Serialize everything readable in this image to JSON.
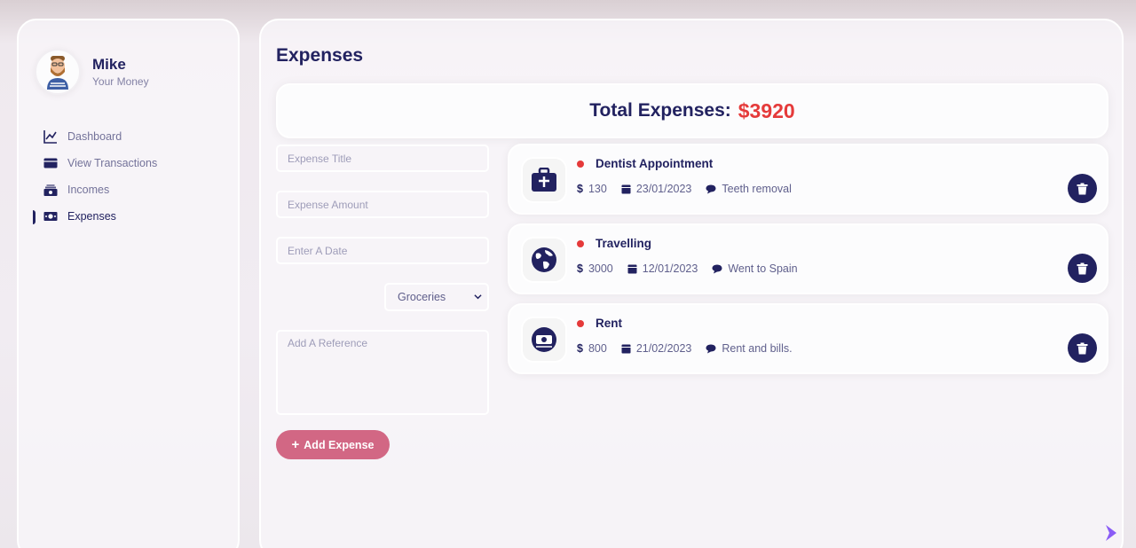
{
  "user": {
    "name": "Mike",
    "subtitle": "Your Money"
  },
  "menu": [
    {
      "label": "Dashboard",
      "icon": "chart-line-icon"
    },
    {
      "label": "View Transactions",
      "icon": "credit-card-icon"
    },
    {
      "label": "Incomes",
      "icon": "money-bills-icon"
    },
    {
      "label": "Expenses",
      "icon": "money-bill-icon",
      "active": true
    }
  ],
  "page": {
    "title": "Expenses",
    "total_label": "Total Expenses:",
    "total_amount": "$3920"
  },
  "form": {
    "title_placeholder": "Expense Title",
    "amount_placeholder": "Expense Amount",
    "date_placeholder": "Enter A Date",
    "category_selected": "Groceries",
    "reference_placeholder": "Add A Reference",
    "add_button": "Add Expense"
  },
  "expenses": [
    {
      "title": "Dentist Appointment",
      "amount": "130",
      "date": "23/01/2023",
      "description": "Teeth removal",
      "icon": "medical-bag-icon"
    },
    {
      "title": "Travelling",
      "amount": "3000",
      "date": "12/01/2023",
      "description": "Went to Spain",
      "icon": "globe-icon"
    },
    {
      "title": "Rent",
      "amount": "800",
      "date": "21/02/2023",
      "description": "Rent and bills.",
      "icon": "bills-icon"
    }
  ],
  "colors": {
    "primary": "#222260",
    "danger": "#e53a3a",
    "accent": "#d26784"
  }
}
